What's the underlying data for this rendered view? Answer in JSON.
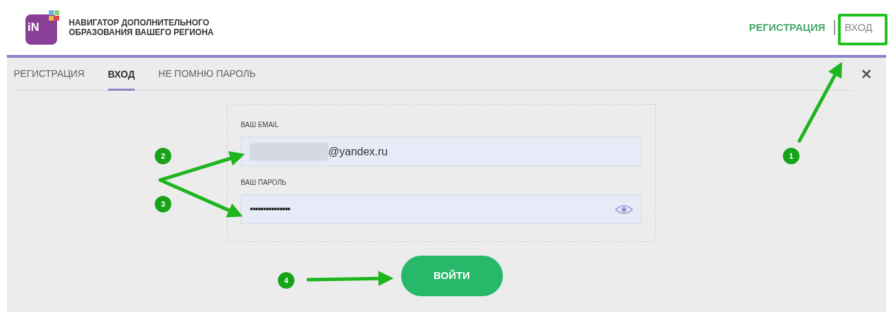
{
  "header": {
    "logo_text": "iN",
    "title_lines": [
      "НАВИГАТОР ДОПОЛНИТЕЛЬНОГО",
      "ОБРАЗОВАНИЯ ВАШЕГО РЕГИОНА"
    ],
    "nav": [
      {
        "label": "РЕГИСТРАЦИЯ",
        "kind": "accent"
      },
      {
        "label": "ВХОД",
        "kind": "plain"
      }
    ]
  },
  "tabs": [
    {
      "label": "РЕГИСТРАЦИЯ",
      "selected": false
    },
    {
      "label": "ВХОД",
      "selected": true
    },
    {
      "label": "НЕ ПОМНЮ ПАРОЛЬ",
      "selected": false
    }
  ],
  "close": "✕",
  "form": {
    "fields": [
      {
        "kind": "email",
        "label": "ВАШ EMAIL",
        "value": "@yandex.ru",
        "redacted": true
      },
      {
        "kind": "password",
        "label": "ВАШ ПАРОЛЬ",
        "value": "•••••••••••••••"
      }
    ],
    "submit": "ВОЙТИ"
  },
  "annotations": [
    "1",
    "2",
    "3",
    "4"
  ]
}
